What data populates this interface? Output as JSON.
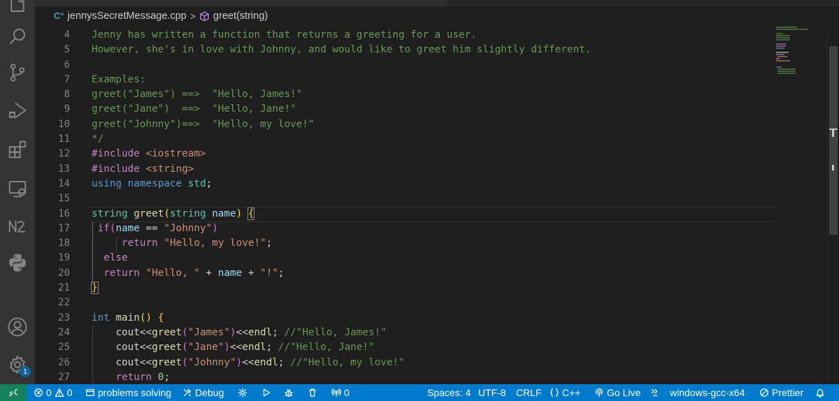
{
  "breadcrumb": {
    "file_icon": "C",
    "file_icon_suffix": "+",
    "file": "jennysSecretMessage.cpp",
    "separator": ">",
    "symbol": "greet(string)"
  },
  "editor": {
    "line_numbers": [
      "4",
      "5",
      "6",
      "7",
      "8",
      "9",
      "10",
      "11",
      "12",
      "13",
      "14",
      "15",
      "16",
      "17",
      "18",
      "19",
      "20",
      "21",
      "22",
      "23",
      "24",
      "25",
      "26",
      "27"
    ]
  },
  "code": {
    "l4": "Jenny has written a function that returns a greeting for a user.",
    "l5": "However, she's in love with Johnny, and would like to greet him slightly different.",
    "l7": "Examples:",
    "l8": "greet(\"James\") ==>  \"Hello, James!\"",
    "l9": "greet(\"Jane\")  ==>  \"Hello, Jane!\"",
    "l10": "greet(\"Johnny\")==>  \"Hello, my love!\"",
    "l11": "*/",
    "l12_dir": "#include ",
    "l12_hdr": "<iostream>",
    "l13_dir": "#include ",
    "l13_hdr": "<string>",
    "l14_kw1": "using",
    "l14_kw2": "namespace",
    "l14_ns": "std",
    "l14_semi": ";",
    "l16_type": "string",
    "l16_fn": "greet",
    "l16_open": "(",
    "l16_ptype": "string",
    "l16_param": "name",
    "l16_close": ")",
    "l16_brace": "{",
    "l17_if": "if",
    "l17_open": "(",
    "l17_var": "name",
    "l17_op": " == ",
    "l17_str": "\"Johnny\"",
    "l17_close": ")",
    "l18_kw": "return",
    "l18_str": "\"Hello, my love!\"",
    "l18_semi": ";",
    "l19_kw": "else",
    "l20_kw": "return",
    "l20_str1": "\"Hello, \"",
    "l20_op1": " + ",
    "l20_var": "name",
    "l20_op2": " + ",
    "l20_str2": "\"!\"",
    "l20_semi": ";",
    "l21_brace": "}",
    "l23_type": "int",
    "l23_fn": "main",
    "l23_parens": "()",
    "l23_brace": "{",
    "l24_a": "cout<<",
    "l24_fn": "greet",
    "l24_p1": "(",
    "l24_str": "\"James\"",
    "l24_p2": ")",
    "l24_b": "<<",
    "l24_endl": "endl",
    "l24_semi": "; ",
    "l24_com": "//\"Hello, James!\"",
    "l25_a": "cout<<",
    "l25_fn": "greet",
    "l25_p1": "(",
    "l25_str": "\"Jane\"",
    "l25_p2": ")",
    "l25_b": "<<",
    "l25_endl": "endl",
    "l25_semi": "; ",
    "l25_com": "//\"Hello, Jane!\"",
    "l26_a": "cout<<",
    "l26_fn": "greet",
    "l26_p1": "(",
    "l26_str": "\"Johnny\"",
    "l26_p2": ")",
    "l26_b": "<<",
    "l26_endl": "endl",
    "l26_semi": "; ",
    "l26_com": "//\"Hello, my love!\"",
    "l27_kw": "return",
    "l27_num": "0",
    "l27_semi": ";"
  },
  "activity_bar": {
    "items": [
      "explorer-icon",
      "search-icon",
      "source-control-icon",
      "run-debug-icon",
      "extensions-icon",
      "remote-explorer-icon",
      "n2-icon",
      "python-icon",
      "accounts-icon",
      "settings-gear-icon"
    ],
    "settings_badge": "1"
  },
  "status_bar": {
    "errors": "0",
    "warnings": "0",
    "project": "problems solving",
    "debug": "Debug",
    "ports": "0",
    "spaces": "Spaces: 4",
    "encoding": "UTF-8",
    "eol": "CRLF",
    "language": "C++",
    "go_live": "Go Live",
    "config": "windows-gcc-x64",
    "prettier": "Prettier"
  },
  "colors": {
    "activity_bg": "#333333",
    "editor_bg": "#1e1e1e",
    "status_bg": "#007acc",
    "remote_bg": "#16825d",
    "comment": "#6a9955",
    "keyword": "#569cd6",
    "string": "#ce9178"
  }
}
